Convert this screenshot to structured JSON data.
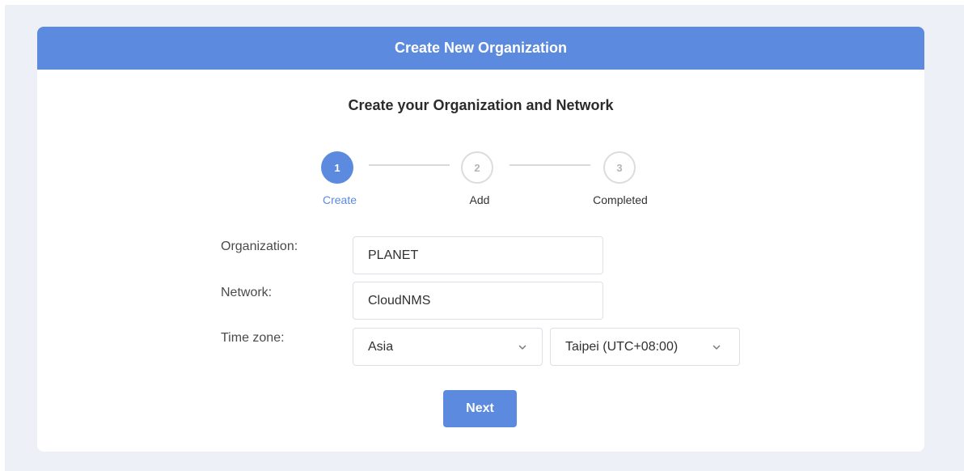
{
  "header": {
    "title": "Create New Organization"
  },
  "main": {
    "subtitle": "Create your Organization and Network"
  },
  "stepper": {
    "steps": [
      {
        "number": "1",
        "label": "Create",
        "state": "active"
      },
      {
        "number": "2",
        "label": "Add",
        "state": "inactive"
      },
      {
        "number": "3",
        "label": "Completed",
        "state": "inactive"
      }
    ]
  },
  "form": {
    "organization_label": "Organization:",
    "organization_value": "PLANET",
    "network_label": "Network:",
    "network_value": "CloudNMS",
    "timezone_label": "Time zone:",
    "region_value": "Asia",
    "city_value": "Taipei (UTC+08:00)"
  },
  "actions": {
    "next_label": "Next"
  },
  "colors": {
    "accent": "#5b8ade",
    "page_background": "#eef0f8",
    "inactive_step": "#dcdcdc"
  },
  "icons": {
    "select_arrow": "chevron-down-icon"
  }
}
